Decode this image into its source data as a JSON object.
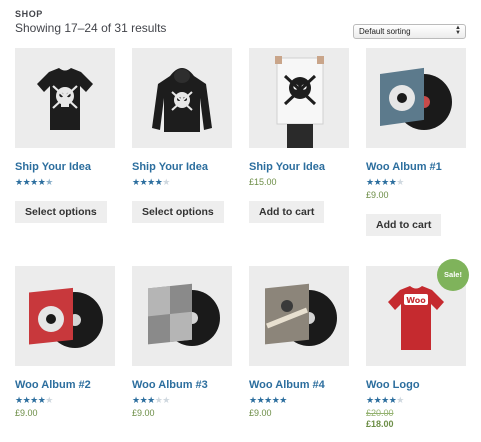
{
  "header": {
    "crumb": "SHOP",
    "result_count": "Showing 17–24 of 31 results",
    "sorting": "Default sorting"
  },
  "colors": {
    "link": "#2c6e9e",
    "price": "#6d8e47",
    "sale": "#7fb35b"
  },
  "products": [
    {
      "title": "Ship Your Idea",
      "rating": 4.5,
      "button": "Select options",
      "image": "t-shirt"
    },
    {
      "title": "Ship Your Idea",
      "rating": 4,
      "button": "Select options",
      "image": "hoodie"
    },
    {
      "title": "Ship Your Idea",
      "price": "£15.00",
      "button": "Add to cart",
      "image": "poster"
    },
    {
      "title": "Woo Album #1",
      "rating": 4,
      "price": "£9.00",
      "button": "Add to cart",
      "image": "album"
    },
    {
      "title": "Woo Album #2",
      "rating": 4,
      "price": "£9.00",
      "image": "album"
    },
    {
      "title": "Woo Album #3",
      "rating": 3,
      "price": "£9.00",
      "image": "album"
    },
    {
      "title": "Woo Album #4",
      "rating": 5,
      "price": "£9.00",
      "image": "album"
    },
    {
      "title": "Woo Logo",
      "rating": 4,
      "old_price": "£20.00",
      "price": "£18.00",
      "sale_badge": "Sale!",
      "image": "t-shirt"
    }
  ]
}
